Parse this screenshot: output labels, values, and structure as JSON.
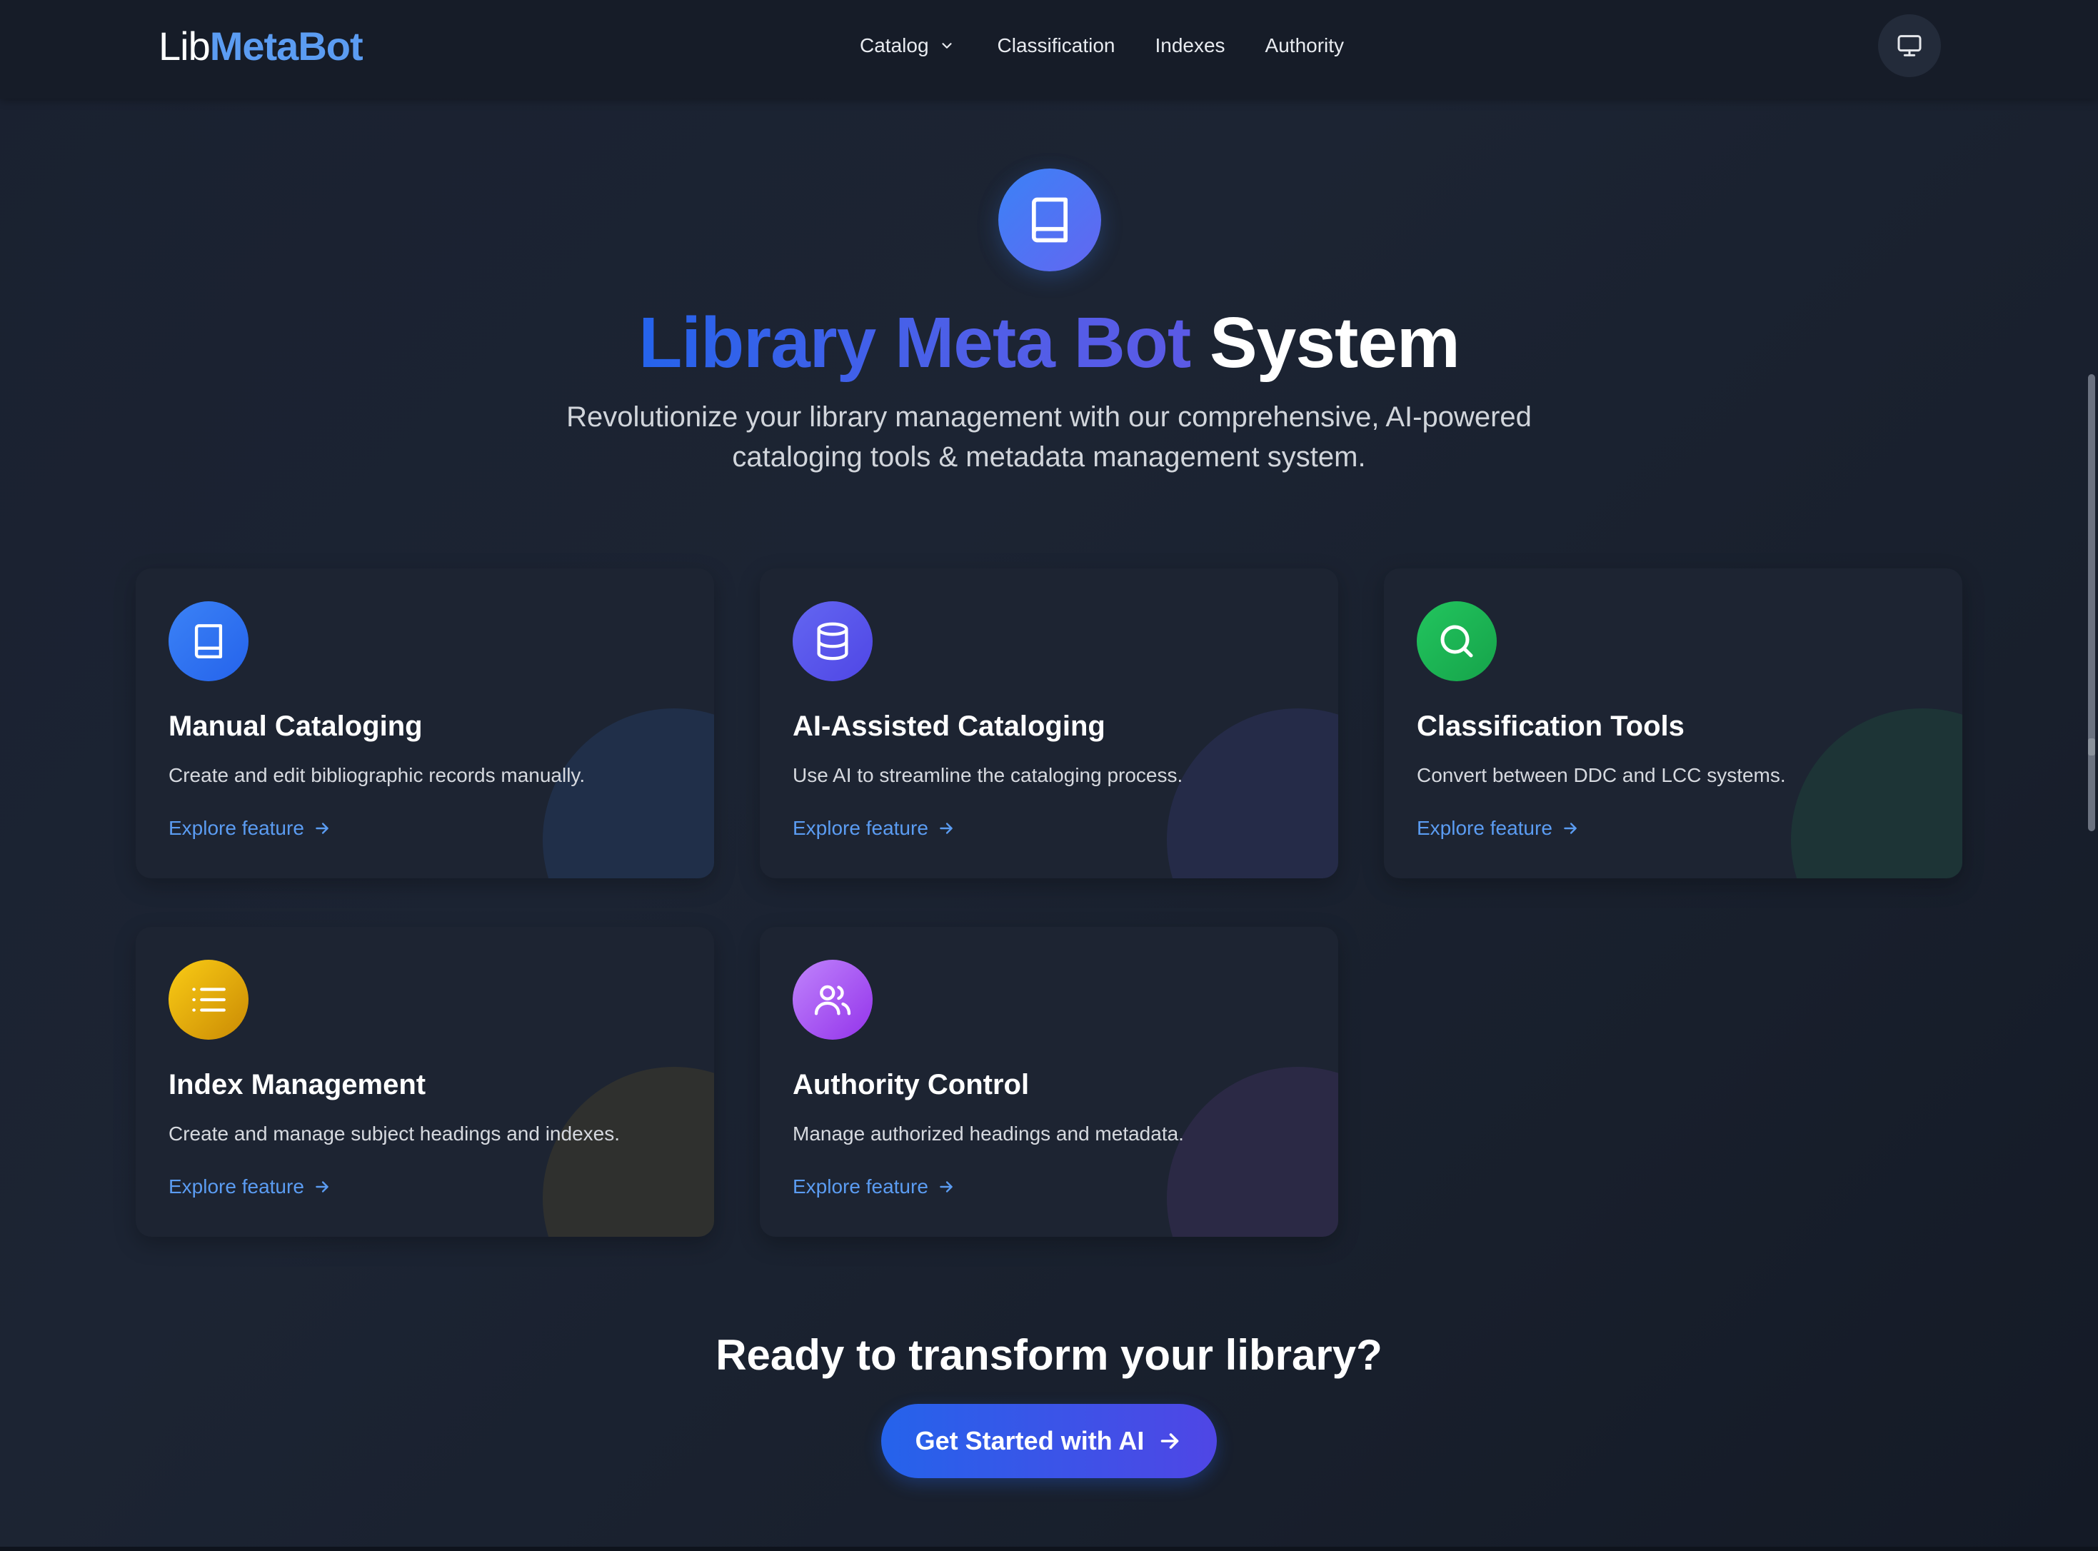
{
  "colors": {
    "accent": "#5b9cf2",
    "brand_blue": "#2563eb",
    "brand_indigo": "#4f46e5"
  },
  "nav": {
    "logo_prefix": "Lib",
    "logo_suffix": "MetaBot",
    "links": [
      {
        "label": "Catalog",
        "has_dropdown": true
      },
      {
        "label": "Classification"
      },
      {
        "label": "Indexes"
      },
      {
        "label": "Authority"
      }
    ],
    "monitor_icon": "monitor-icon",
    "dropdown_icon": "chevron-down-icon"
  },
  "hero": {
    "icon": "book-icon",
    "title_highlight": "Library Meta Bot",
    "title_plain": "System",
    "subtitle": "Revolutionize your library management with our comprehensive, AI-powered cataloging tools & metadata management system."
  },
  "features": [
    {
      "title": "Manual Cataloging",
      "description": "Create and edit bibliographic records manually.",
      "link": "Explore feature",
      "icon": "book-icon",
      "color": "#3b82f6"
    },
    {
      "title": "AI-Assisted Cataloging",
      "description": "Use AI to streamline the cataloging process.",
      "link": "Explore feature",
      "icon": "database-icon",
      "color": "#6366f1"
    },
    {
      "title": "Classification Tools",
      "description": "Convert between DDC and LCC systems.",
      "link": "Explore feature",
      "icon": "search-icon",
      "color": "#22c55e"
    },
    {
      "title": "Index Management",
      "description": "Create and manage subject headings and indexes.",
      "link": "Explore feature",
      "icon": "list-icon",
      "color": "#eab308"
    },
    {
      "title": "Authority Control",
      "description": "Manage authorized headings and metadata.",
      "link": "Explore feature",
      "icon": "users-icon",
      "color": "#a855f7"
    }
  ],
  "cta": {
    "title": "Ready to transform your library?",
    "button_label": "Get Started with AI",
    "button_icon": "arrow-right-icon"
  }
}
